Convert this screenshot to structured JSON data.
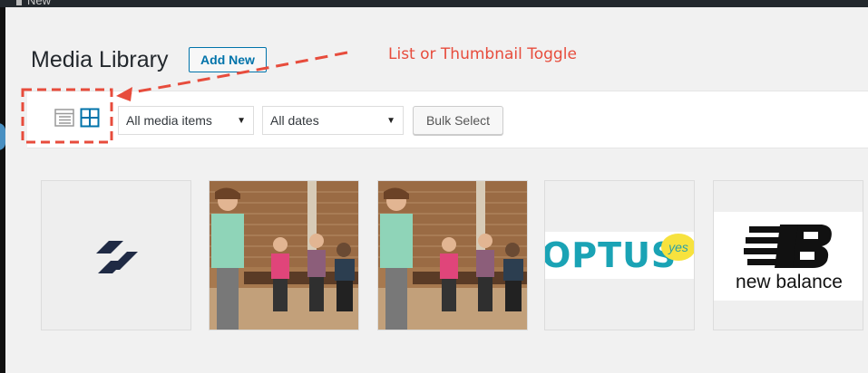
{
  "admin_bar": {
    "new_label": "New"
  },
  "header": {
    "title": "Media Library",
    "add_new_label": "Add New"
  },
  "annotation": {
    "text": "List or Thumbnail Toggle",
    "color": "#e74c3c"
  },
  "toolbar": {
    "view_modes": [
      {
        "icon": "list-view-icon",
        "active": false
      },
      {
        "icon": "grid-view-icon",
        "active": true
      }
    ],
    "media_filter": {
      "selected": "All media items"
    },
    "date_filter": {
      "selected": "All dates"
    },
    "bulk_select_label": "Bulk Select"
  },
  "media_items": [
    {
      "type": "logo",
      "description": "S logo"
    },
    {
      "type": "photo",
      "description": "coach with kids on gym bench"
    },
    {
      "type": "photo",
      "description": "coach with kids on gym bench"
    },
    {
      "type": "logo",
      "brand_text": "OPTUS",
      "tag": "yes"
    },
    {
      "type": "logo",
      "brand_text": "new balance"
    }
  ],
  "colors": {
    "accent": "#0073aa",
    "admin_bar": "#23282d",
    "background": "#f1f1f1"
  }
}
